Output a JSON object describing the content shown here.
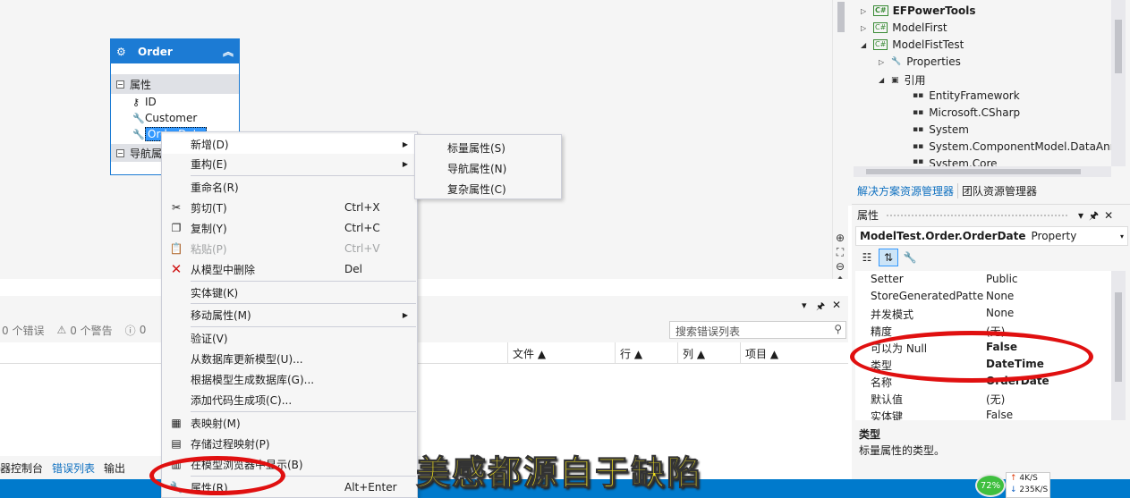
{
  "entity": {
    "name": "Order",
    "properties_section": "属性",
    "properties": [
      "ID",
      "Customer",
      "OrderDate"
    ],
    "nav_section": "导航属性"
  },
  "context_menu": {
    "items": [
      {
        "label": "新增(D)",
        "shortcut": "",
        "submenu": true,
        "icon": ""
      },
      {
        "label": "重构(E)",
        "shortcut": "",
        "submenu": true,
        "icon": ""
      },
      {
        "label": "重命名(R)",
        "shortcut": "",
        "submenu": false,
        "icon": ""
      },
      {
        "label": "剪切(T)",
        "shortcut": "Ctrl+X",
        "submenu": false,
        "icon": "scissors-icon"
      },
      {
        "label": "复制(Y)",
        "shortcut": "Ctrl+C",
        "submenu": false,
        "icon": "copy-icon"
      },
      {
        "label": "粘贴(P)",
        "shortcut": "Ctrl+V",
        "submenu": false,
        "icon": "paste-icon"
      },
      {
        "label": "从模型中删除",
        "shortcut": "Del",
        "submenu": false,
        "icon": "delete-x-icon"
      },
      {
        "label": "实体键(K)",
        "shortcut": "",
        "submenu": false,
        "icon": ""
      },
      {
        "label": "移动属性(M)",
        "shortcut": "",
        "submenu": true,
        "icon": ""
      },
      {
        "label": "验证(V)",
        "shortcut": "",
        "submenu": false,
        "icon": ""
      },
      {
        "label": "从数据库更新模型(U)...",
        "shortcut": "",
        "submenu": false,
        "icon": ""
      },
      {
        "label": "根据模型生成数据库(G)...",
        "shortcut": "",
        "submenu": false,
        "icon": ""
      },
      {
        "label": "添加代码生成项(C)...",
        "shortcut": "",
        "submenu": false,
        "icon": ""
      },
      {
        "label": "表映射(M)",
        "shortcut": "",
        "submenu": false,
        "icon": "table-mapping-icon"
      },
      {
        "label": "存储过程映射(P)",
        "shortcut": "",
        "submenu": false,
        "icon": "sproc-mapping-icon"
      },
      {
        "label": "在模型浏览器中显示(B)",
        "shortcut": "",
        "submenu": false,
        "icon": "model-browser-icon"
      },
      {
        "label": "属性(R)",
        "shortcut": "Alt+Enter",
        "submenu": false,
        "icon": "wrench-icon"
      }
    ]
  },
  "submenu": {
    "items": [
      "标量属性(S)",
      "导航属性(N)",
      "复杂属性(C)"
    ]
  },
  "error_list": {
    "errors": "0 个错误",
    "warnings": "0 个警告",
    "messages": "0",
    "search_placeholder": "搜索错误列表",
    "columns": [
      "文件",
      "行",
      "列",
      "项目"
    ]
  },
  "bottom_tabs": [
    "器控制台",
    "错误列表",
    "输出"
  ],
  "solution_explorer": {
    "nodes": [
      "EFPowerTools",
      "ModelFirst",
      "ModelFistTest",
      "Properties",
      "引用",
      "EntityFramework",
      "Microsoft.CSharp",
      "System",
      "System.ComponentModel.DataAnn",
      "System.Core"
    ],
    "tabs": [
      "解决方案资源管理器",
      "团队资源管理器"
    ]
  },
  "properties": {
    "title": "属性",
    "object_name": "ModelTest.Order.OrderDate",
    "object_type": "Property",
    "rows": [
      {
        "key": "Setter",
        "value": "Public",
        "bold": false
      },
      {
        "key": "StoreGeneratedPatter",
        "value": "None",
        "bold": false
      },
      {
        "key": "并发模式",
        "value": "None",
        "bold": false
      },
      {
        "key": "精度",
        "value": "(无)",
        "bold": false
      },
      {
        "key": "可以为 Null",
        "value": "False",
        "bold": true
      },
      {
        "key": "类型",
        "value": "DateTime",
        "bold": true
      },
      {
        "key": "名称",
        "value": "OrderDate",
        "bold": true
      },
      {
        "key": "默认值",
        "value": "(无)",
        "bold": false
      },
      {
        "key": "实体键",
        "value": "False",
        "bold": false
      }
    ],
    "desc_title": "类型",
    "desc_text": "标量属性的类型。"
  },
  "subtitle": "美感都源自于缺陷",
  "network": {
    "percent": "72%",
    "up": "4K/S",
    "down": "235K/S"
  },
  "colors": {
    "accent": "#1c7bd4",
    "statusbar": "#007acc",
    "annotation": "#e01010",
    "subtitle": "#f0e020"
  }
}
